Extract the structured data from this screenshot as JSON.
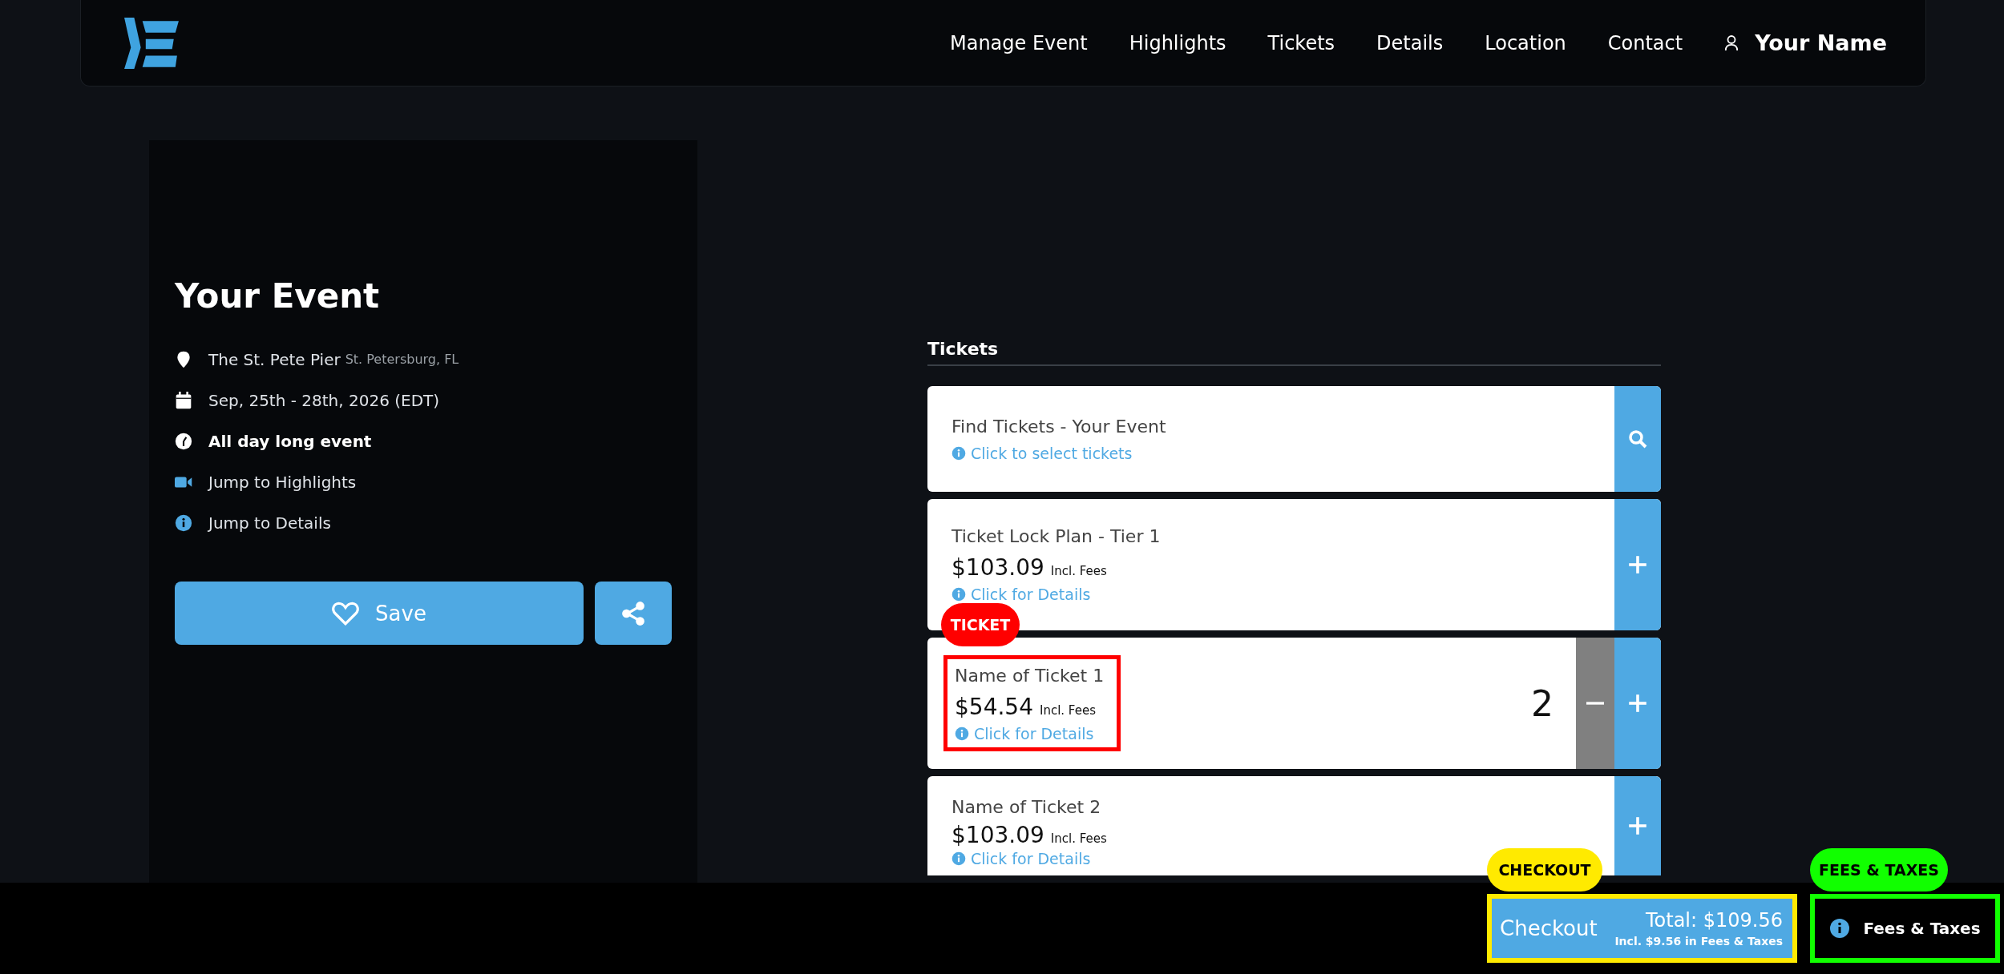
{
  "nav": {
    "links": [
      "Manage Event",
      "Highlights",
      "Tickets",
      "Details",
      "Location",
      "Contact"
    ],
    "user": "Your Name"
  },
  "event": {
    "title": "Your Event",
    "venue": "The St. Pete Pier",
    "city": "St. Petersburg, FL",
    "dates": "Sep, 25th - 28th, 2026 (EDT)",
    "time": "All day long event",
    "highlights_link": "Jump to Highlights",
    "details_link": "Jump to Details",
    "save": "Save"
  },
  "tickets": {
    "heading": "Tickets",
    "items": [
      {
        "kind": "search",
        "name": "Find Tickets - Your Event",
        "link": "Click to select tickets"
      },
      {
        "kind": "ticket",
        "name": "Ticket Lock Plan - Tier 1",
        "price": "$103.09",
        "fee_note": "Incl. Fees",
        "link": "Click for Details"
      },
      {
        "kind": "ticket",
        "name": "Name of Ticket 1",
        "price": "$54.54",
        "fee_note": "Incl. Fees",
        "link": "Click for Details",
        "quantity": "2",
        "annotation": {
          "label": "TICKET",
          "color": "#ff0000"
        }
      },
      {
        "kind": "ticket",
        "name": "Name of Ticket 2",
        "price": "$103.09",
        "fee_note": "Incl. Fees",
        "link": "Click for Details"
      }
    ]
  },
  "checkout": {
    "label": "Checkout",
    "total": "Total: $109.56",
    "fees_note": "Incl. $9.56 in Fees & Taxes",
    "annotation": {
      "label": "CHECKOUT",
      "color": "#ffea00"
    }
  },
  "fees_button": {
    "label": "Fees & Taxes",
    "annotation": {
      "label": "FEES & TAXES",
      "color": "#11ff00"
    }
  }
}
